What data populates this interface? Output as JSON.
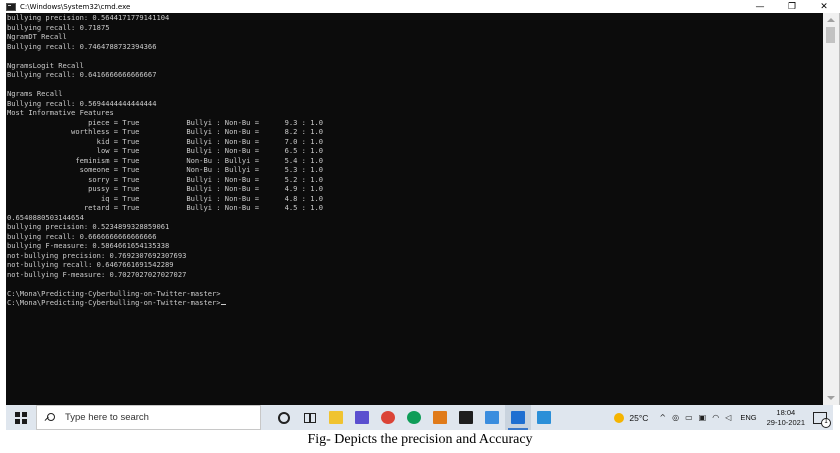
{
  "window": {
    "title": "C:\\Windows\\System32\\cmd.exe",
    "minimize_glyph": "—",
    "maximize_glyph": "❐",
    "close_glyph": "✕"
  },
  "console": {
    "lines": [
      "bullying precision: 0.5644171779141104",
      "bullying recall: 0.71875",
      "NgramDT Recall",
      "Bullying recall: 0.7464788732394366",
      "",
      "NgramsLogit Recall",
      "Bullying recall: 0.6416666666666667",
      "",
      "Ngrams Recall",
      "Bullying recall: 0.5694444444444444",
      "Most Informative Features",
      "                   piece = True           Bullyi : Non-Bu =      9.3 : 1.0",
      "               worthless = True           Bullyi : Non-Bu =      8.2 : 1.0",
      "                     kid = True           Bullyi : Non-Bu =      7.0 : 1.0",
      "                     low = True           Bullyi : Non-Bu =      6.5 : 1.0",
      "                feminism = True           Non-Bu : Bullyi =      5.4 : 1.0",
      "                 someone = True           Non-Bu : Bullyi =      5.3 : 1.0",
      "                   sorry = True           Bullyi : Non-Bu =      5.2 : 1.0",
      "                   pussy = True           Bullyi : Non-Bu =      4.9 : 1.0",
      "                      iq = True           Bullyi : Non-Bu =      4.8 : 1.0",
      "                  retard = True           Bullyi : Non-Bu =      4.5 : 1.0",
      "0.6540880503144654",
      "bullying precision: 0.5234899328859061",
      "bullying recall: 0.6666666666666666",
      "bullying F-measure: 0.5864661654135338",
      "not-bullying precision: 0.7692307692307693",
      "not-bullying recall: 0.6467661691542289",
      "not-bullying F-measure: 0.7027027027027027",
      "",
      "C:\\Mona\\Predicting-Cyberbulling-on-Twitter-master>",
      "C:\\Mona\\Predicting-Cyberbulling-on-Twitter-master>"
    ]
  },
  "taskbar": {
    "search_placeholder": "Type here to search",
    "weather_temp": "25°C",
    "language": "ENG",
    "time": "18:04",
    "date": "29-10-2021",
    "icons": [
      {
        "name": "cortana-icon"
      },
      {
        "name": "task-view-icon"
      },
      {
        "name": "file-explorer-icon",
        "color": "#f0c330"
      },
      {
        "name": "app-badge-icon",
        "color": "#5a4fcf"
      },
      {
        "name": "chrome-icon",
        "color": "#db4437"
      },
      {
        "name": "chrome-alt-icon",
        "color": "#0f9d58"
      },
      {
        "name": "sync-icon",
        "color": "#e07b1a"
      },
      {
        "name": "terminal-icon",
        "color": "#1e1e1e"
      },
      {
        "name": "monitor-icon",
        "color": "#3a8dde"
      },
      {
        "name": "settings-icon",
        "color": "#1f6fd1"
      },
      {
        "name": "vscode-icon",
        "color": "#2b8fd8"
      }
    ]
  },
  "caption": "Fig- Depicts the precision and Accuracy"
}
